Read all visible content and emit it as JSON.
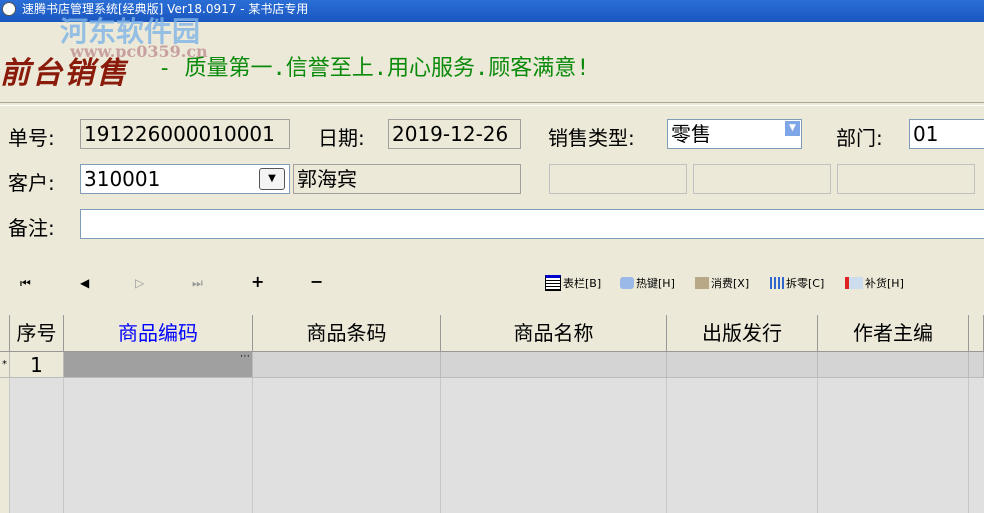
{
  "window": {
    "title": "速腾书店管理系统[经典版] Ver18.0917  -  某书店专用"
  },
  "watermark": {
    "name": "河东软件园",
    "url": "www.pc0359.cn"
  },
  "header": {
    "logo": "前台销售",
    "slogan": "- 质量第一.信誉至上.用心服务.顾客满意!"
  },
  "form": {
    "order_no_label": "单号:",
    "order_no": "191226000010001",
    "date_label": "日期:",
    "date": "2019-12-26",
    "sale_type_label": "销售类型:",
    "sale_type": "零售",
    "dept_label": "部门:",
    "dept": "01",
    "customer_label": "客户:",
    "customer_code": "310001",
    "customer_name": "郭海宾",
    "remark_label": "备注:",
    "remark": ""
  },
  "toolbar": {
    "first": "⏮",
    "prev": "◀",
    "next": "▷",
    "last": "⏭",
    "add": "+",
    "remove": "−",
    "buttons": [
      {
        "label": "表栏[B]"
      },
      {
        "label": "热键[H]"
      },
      {
        "label": "消费[X]"
      },
      {
        "label": "拆零[C]"
      },
      {
        "label": "补货[H]"
      }
    ]
  },
  "grid": {
    "columns": [
      "序号",
      "商品编码",
      "商品条码",
      "商品名称",
      "出版发行",
      "作者主编"
    ],
    "rows": [
      {
        "seq": "1",
        "marker": "*"
      }
    ]
  }
}
